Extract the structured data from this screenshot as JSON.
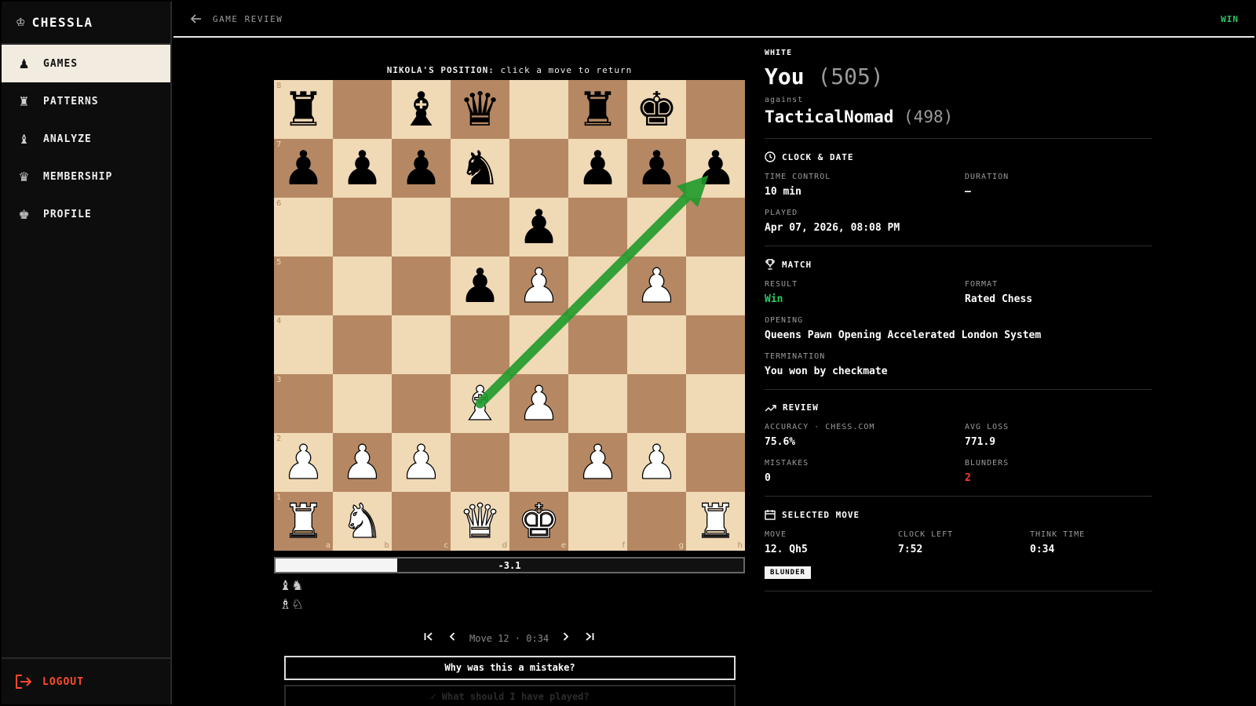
{
  "app": {
    "name": "CHESSLA"
  },
  "sidebar": {
    "items": [
      {
        "label": "GAMES",
        "icon": "♟",
        "icon_name": "pawn-icon",
        "active": true
      },
      {
        "label": "PATTERNS",
        "icon": "♜",
        "icon_name": "rook-icon",
        "active": false
      },
      {
        "label": "ANALYZE",
        "icon": "♝",
        "icon_name": "bishop-icon",
        "active": false
      },
      {
        "label": "MEMBERSHIP",
        "icon": "♛",
        "icon_name": "queen-icon",
        "active": false
      },
      {
        "label": "PROFILE",
        "icon": "♚",
        "icon_name": "king-icon",
        "active": false
      }
    ],
    "logout_label": "LOGOUT"
  },
  "topbar": {
    "title": "GAME REVIEW",
    "result": "WIN"
  },
  "board": {
    "caption_name": "NIKOLA'S POSITION:",
    "caption_hint": " click a move to return",
    "position": [
      [
        "bR",
        "",
        "bB",
        "bQ",
        "",
        "bR",
        "bK",
        ""
      ],
      [
        "bP",
        "bP",
        "bP",
        "bN",
        "",
        "bP",
        "bP",
        "bP"
      ],
      [
        "",
        "",
        "",
        "",
        "bP",
        "",
        "",
        ""
      ],
      [
        "",
        "",
        "",
        "bP",
        "wP",
        "",
        "wP",
        ""
      ],
      [
        "",
        "",
        "",
        "",
        "",
        "",
        "",
        ""
      ],
      [
        "",
        "",
        "",
        "wB",
        "wP",
        "",
        "",
        ""
      ],
      [
        "wP",
        "wP",
        "wP",
        "",
        "",
        "wP",
        "wP",
        ""
      ],
      [
        "wR",
        "wN",
        "",
        "wQ",
        "wK",
        "",
        "",
        "wR"
      ]
    ],
    "ranks": [
      "8",
      "7",
      "6",
      "5",
      "4",
      "3",
      "2",
      "1"
    ],
    "files": [
      "a",
      "b",
      "c",
      "d",
      "e",
      "f",
      "g",
      "h"
    ],
    "arrow": {
      "from": "d3",
      "to": "h7",
      "color": "#1f9a2b"
    }
  },
  "eval": {
    "text": "-3.1",
    "white_share": 0.26
  },
  "captured": {
    "by_black": "♝♞",
    "by_white": "♗♘"
  },
  "move_nav": {
    "label": "Move 12 · 0:34"
  },
  "buttons": {
    "why": "Why was this a mistake?",
    "what": "✓ What should I have played?"
  },
  "info": {
    "white_label": "WHITE",
    "player": {
      "name": "You",
      "rating": "(505)"
    },
    "against": "against",
    "opponent": {
      "name": "TacticalNomad",
      "rating": "(498)"
    },
    "clock": {
      "heading": "CLOCK & DATE",
      "time_control_label": "TIME CONTROL",
      "time_control": "10 min",
      "duration_label": "DURATION",
      "duration": "—",
      "played_label": "PLAYED",
      "played": "Apr 07, 2026, 08:08 PM"
    },
    "match": {
      "heading": "MATCH",
      "result_label": "RESULT",
      "result": "Win",
      "format_label": "FORMAT",
      "format": "Rated Chess",
      "opening_label": "OPENING",
      "opening": "Queens Pawn Opening Accelerated London System",
      "termination_label": "TERMINATION",
      "termination": "You won by checkmate"
    },
    "review": {
      "heading": "REVIEW",
      "accuracy_label": "ACCURACY · CHESS.COM",
      "accuracy": "75.6%",
      "avg_loss_label": "AVG LOSS",
      "avg_loss": "771.9",
      "mistakes_label": "MISTAKES",
      "mistakes": "0",
      "blunders_label": "BLUNDERS",
      "blunders": "2"
    },
    "selected": {
      "heading": "SELECTED MOVE",
      "move_label": "MOVE",
      "move": "12. Qh5",
      "clock_left_label": "CLOCK LEFT",
      "clock_left": "7:52",
      "think_time_label": "THINK TIME",
      "think_time": "0:34",
      "badge": "BLUNDER"
    }
  },
  "colors": {
    "accent_green": "#2ec862",
    "danger_red": "#ff3b30",
    "logout_orange": "#ff4a2a",
    "board_light": "#f0d9b5",
    "board_dark": "#b58863"
  }
}
